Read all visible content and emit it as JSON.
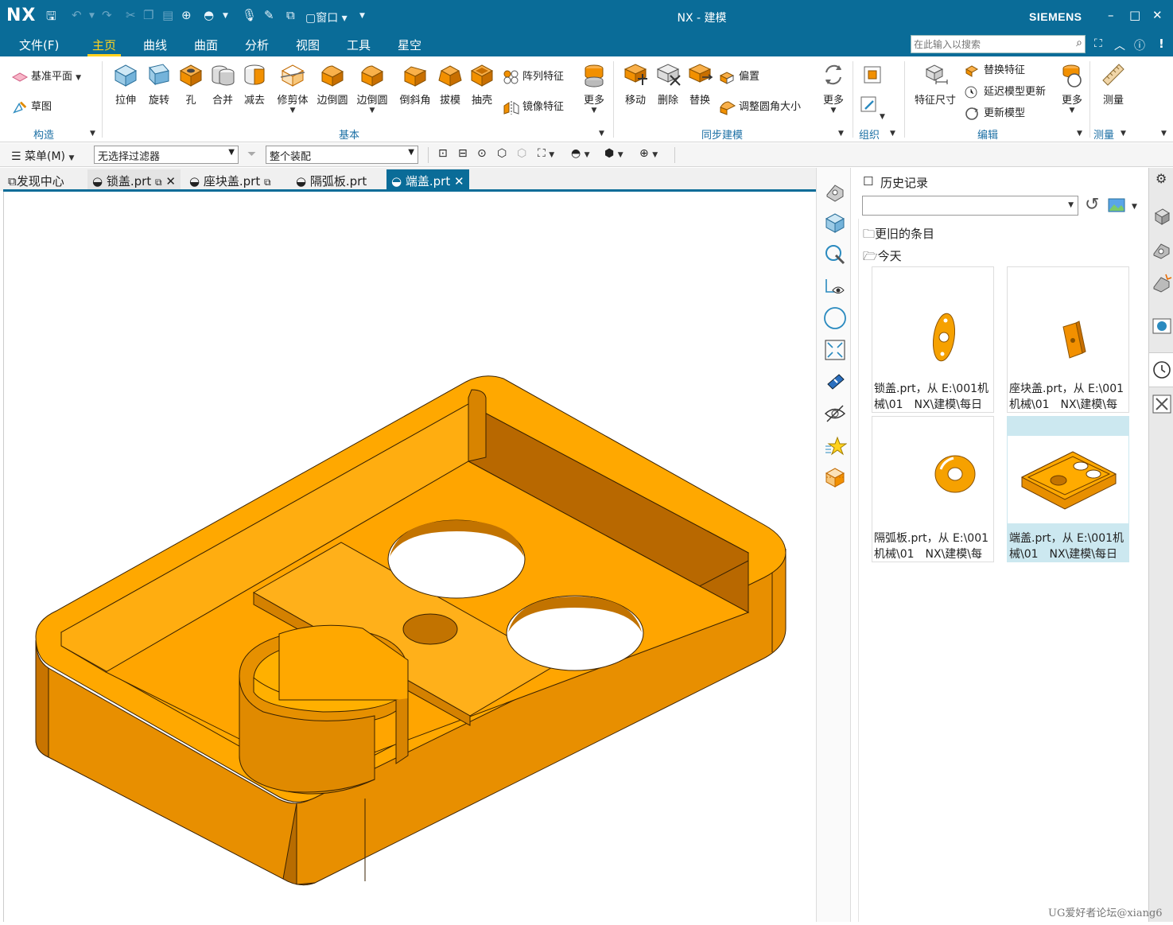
{
  "titlebar": {
    "logo": "NX",
    "title": "NX - 建模",
    "brand": "SIEMENS",
    "window_menu": "窗口",
    "controls": {
      "minimize": "–",
      "maximize": "□",
      "close": "✕"
    }
  },
  "menu": {
    "tabs": [
      "文件(F)",
      "主页",
      "曲线",
      "曲面",
      "分析",
      "视图",
      "工具",
      "星空"
    ],
    "active": "主页",
    "search_placeholder": "在此输入以搜索"
  },
  "ribbon": {
    "construct": {
      "datum_plane": "基准平面",
      "sketch": "草图",
      "group": "构造"
    },
    "basic": {
      "buttons": [
        "拉伸",
        "旋转",
        "孔",
        "合并",
        "减去",
        "修剪体",
        "边倒圆",
        "边倒圆",
        "倒斜角",
        "拔模",
        "抽壳"
      ],
      "pattern": "阵列特征",
      "mirror": "镜像特征",
      "more": "更多",
      "group": "基本"
    },
    "sync": {
      "buttons": [
        "移动",
        "删除",
        "替换"
      ],
      "offset": "偏置",
      "resize_blend": "调整圆角大小",
      "more": "更多",
      "group": "同步建模"
    },
    "organize": {
      "group": "组织"
    },
    "edit": {
      "feature_dim": "特征尺寸",
      "replace_feature": "替换特征",
      "delay_update": "延迟模型更新",
      "update_model": "更新模型",
      "more": "更多",
      "group": "编辑"
    },
    "measure": {
      "button": "测量",
      "group": "测量"
    }
  },
  "filterbar": {
    "menu": "菜单(M)",
    "filter": "无选择过滤器",
    "scope": "整个装配"
  },
  "doctabs": [
    {
      "label": "发现中心",
      "active": false
    },
    {
      "label": "锁盖.prt",
      "active": false
    },
    {
      "label": "座块盖.prt",
      "active": false
    },
    {
      "label": "隔弧板.prt",
      "active": false
    },
    {
      "label": "端盖.prt",
      "active": true
    }
  ],
  "history": {
    "title": "历史记录",
    "older": "更旧的条目",
    "today": "今天",
    "items": [
      {
        "caption": "锁盖.prt，从 E:\\001机械\\01　NX\\建模\\每日"
      },
      {
        "caption": "座块盖.prt，从 E:\\001机械\\01　NX\\建模\\每"
      },
      {
        "caption": "隔弧板.prt，从 E:\\001机械\\01　NX\\建模\\每"
      },
      {
        "caption": "端盖.prt，从 E:\\001机械\\01　NX\\建模\\每日"
      }
    ]
  },
  "watermark": "UG爱好者论坛@xiang6",
  "colors": {
    "accent": "#0a6c98",
    "active_tab": "#ffd21e",
    "part": "#f6a100"
  }
}
